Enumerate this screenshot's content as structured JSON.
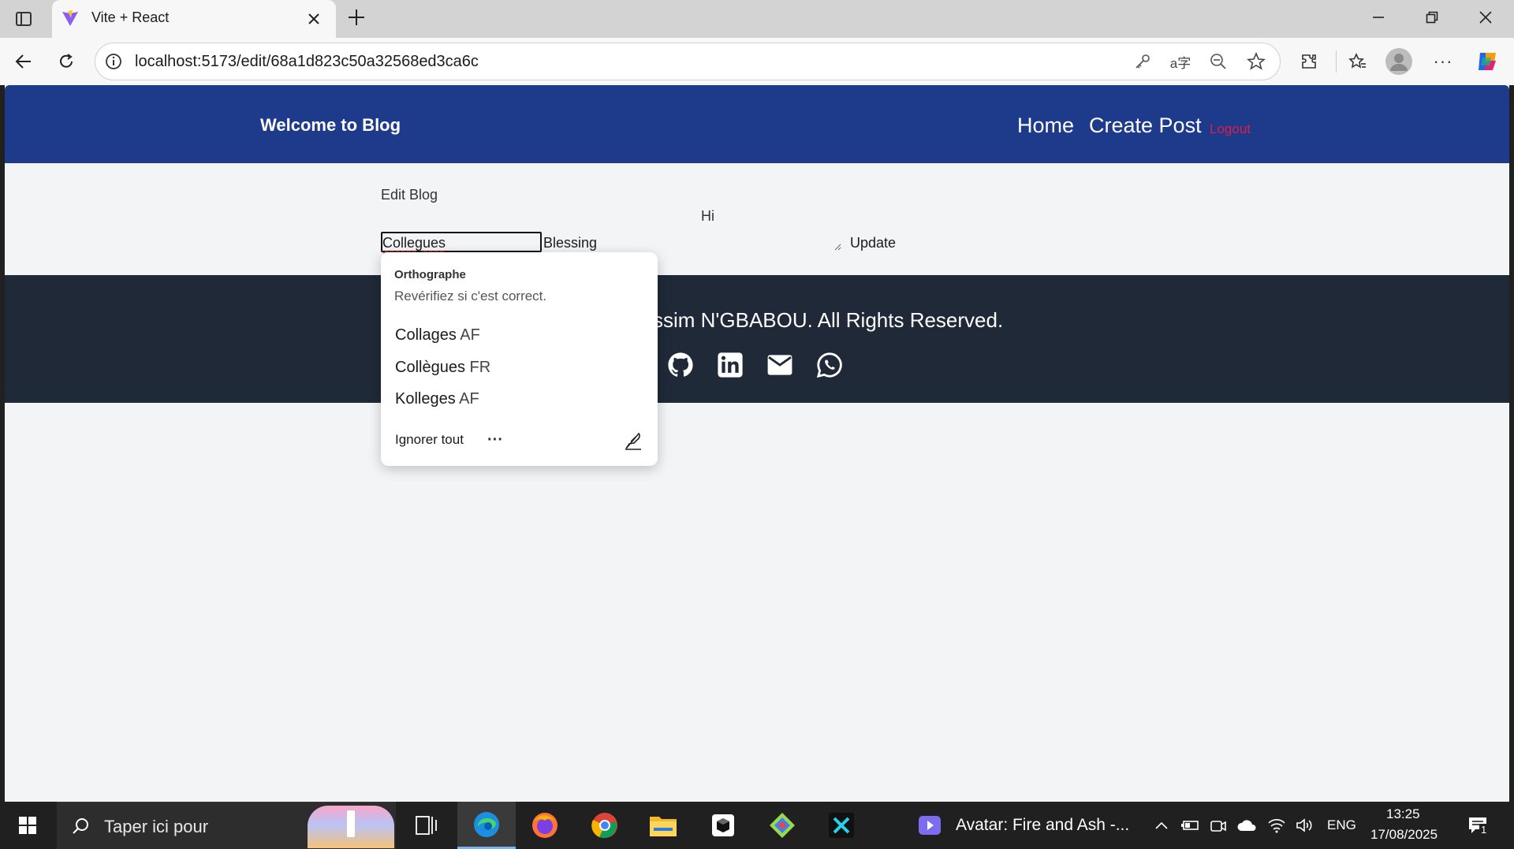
{
  "browser": {
    "tab_title": "Vite + React",
    "url": "localhost:5173/edit/68a1d823c50a32568ed3ca6c"
  },
  "header": {
    "brand": "Welcome to Blog",
    "nav": {
      "home": "Home",
      "create": "Create Post",
      "logout": "Logout"
    }
  },
  "editor": {
    "heading": "Edit Blog",
    "hi": "Hi",
    "title_value": "Collegues",
    "content_value": "Blessing",
    "update_label": "Update"
  },
  "footer": {
    "copyright": "ssim N'GBABOU. All Rights Reserved."
  },
  "spellcheck": {
    "title": "Orthographe",
    "subtitle": "Revérifiez si c'est correct.",
    "suggestions": [
      {
        "word": "Collages",
        "lang": "AF"
      },
      {
        "word": "Collègues",
        "lang": "FR"
      },
      {
        "word": "Kolleges",
        "lang": "AF"
      }
    ],
    "ignore_all": "Ignorer tout"
  },
  "taskbar": {
    "search_placeholder": "Taper ici pour",
    "media_title": "Avatar: Fire and Ash -...",
    "lang": "ENG",
    "time": "13:25",
    "date": "17/08/2025",
    "notif_count": "1"
  },
  "colors": {
    "header_bg": "#1e3a8a",
    "footer_bg": "#1f2937",
    "logout": "#e11d48"
  }
}
